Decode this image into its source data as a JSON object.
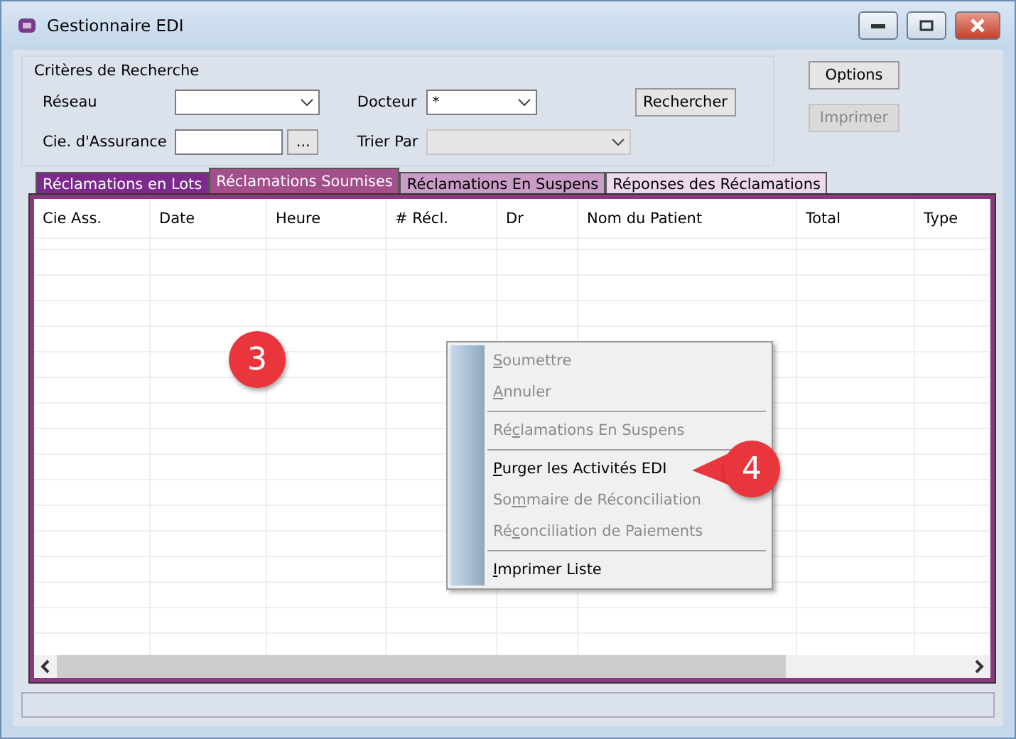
{
  "window": {
    "title": "Gestionnaire EDI"
  },
  "search": {
    "title": "Critères de Recherche",
    "fields": [
      {
        "label": "Réseau",
        "kind": "dropdown",
        "disabled": false
      },
      {
        "label": "Docteur",
        "kind": "dropdown",
        "value": "*",
        "disabled": false
      },
      {
        "label": "Cie. d'Assurance",
        "kind": "lookup",
        "button": "...",
        "disabled": false
      },
      {
        "label": "Trier Par",
        "kind": "dropdown",
        "disabled": true
      }
    ],
    "search_button": "Rechercher"
  },
  "side_buttons": [
    {
      "label": "Options",
      "disabled": false
    },
    {
      "label": "Imprimer",
      "disabled": true
    }
  ],
  "tabs": [
    {
      "label": "Réclamations en Lots",
      "selected": false,
      "color": "#7d2a8e"
    },
    {
      "label": "Réclamations Soumises",
      "selected": true,
      "color": "#a34f8b"
    },
    {
      "label": "Réclamations En Suspens",
      "selected": false,
      "color": "#c99dc6"
    },
    {
      "label": "Réponses des Réclamations",
      "selected": false,
      "color": "#ecd9ec"
    }
  ],
  "table": {
    "columns": [
      "Cie Ass.",
      "Date",
      "Heure",
      "# Récl.",
      "Dr",
      "Nom du Patient",
      "Total",
      "Type"
    ]
  },
  "context_menu": [
    {
      "kind": "item",
      "access_key": "S",
      "rest": "oumettre",
      "disabled": true
    },
    {
      "kind": "item",
      "access_key": "A",
      "rest": "nnuler",
      "disabled": true
    },
    {
      "kind": "separator"
    },
    {
      "kind": "item",
      "before": "Ré",
      "access_key": "c",
      "rest": "lamations En Suspens",
      "disabled": true
    },
    {
      "kind": "separator"
    },
    {
      "kind": "item",
      "access_key": "P",
      "rest": "urger les Activités EDI",
      "disabled": false
    },
    {
      "kind": "item",
      "before": "So",
      "access_key": "m",
      "rest": "maire de Réconciliation",
      "disabled": true
    },
    {
      "kind": "item",
      "before": "Ré",
      "access_key": "c",
      "rest": "onciliation de Paiements",
      "disabled": true
    },
    {
      "kind": "separator"
    },
    {
      "kind": "item",
      "access_key": "I",
      "rest": "mprimer Liste",
      "disabled": false
    }
  ],
  "callouts": [
    {
      "label": "3",
      "kind": "round"
    },
    {
      "label": "4",
      "kind": "pointed"
    }
  ]
}
